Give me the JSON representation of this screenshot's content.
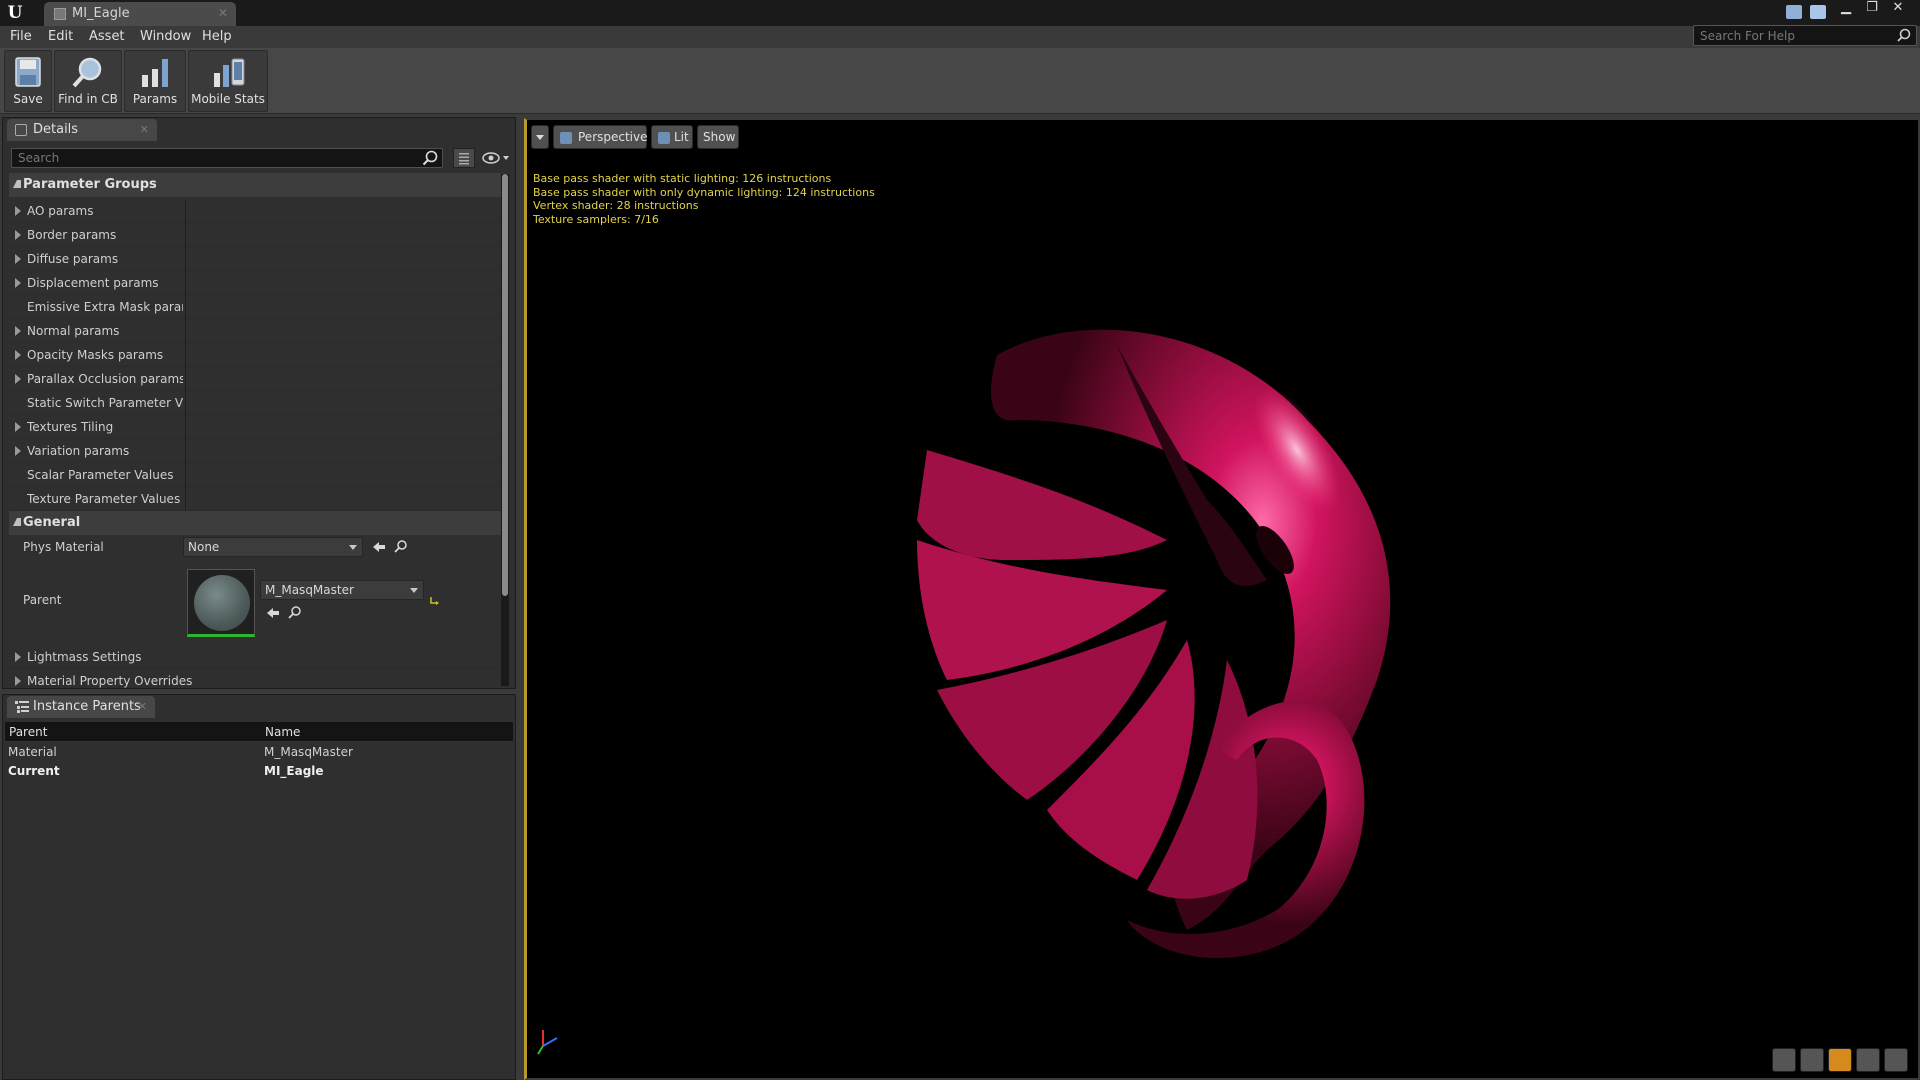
{
  "window": {
    "tab_title": "MI_Eagle"
  },
  "menu": [
    "File",
    "Edit",
    "Asset",
    "Window",
    "Help"
  ],
  "help_search": {
    "placeholder": "Search For Help"
  },
  "toolbar": {
    "save": "Save",
    "find_in_cb": "Find in CB",
    "params": "Params",
    "mobile_stats": "Mobile Stats"
  },
  "details": {
    "tab_label": "Details",
    "search_placeholder": "Search",
    "parameter_groups_header": "Parameter Groups",
    "parameter_groups": [
      "AO params",
      "Border params",
      "Diffuse params",
      "Displacement params",
      "Emissive Extra Mask params",
      "Normal params",
      "Opacity Masks params",
      "Parallax Occlusion params",
      "Static Switch Parameter Values",
      "Textures Tiling",
      "Variation params",
      "Scalar Parameter Values",
      "Texture Parameter Values"
    ],
    "general_header": "General",
    "phys_material_label": "Phys Material",
    "phys_material_value": "None",
    "parent_label": "Parent",
    "parent_value": "M_MasqMaster",
    "lightmass_settings": "Lightmass Settings",
    "material_property_overrides": "Material Property Overrides"
  },
  "instance_parents": {
    "tab_label": "Instance Parents",
    "columns": [
      "Parent",
      "Name"
    ],
    "rows": [
      {
        "parent": "Material",
        "name": "M_MasqMaster",
        "current": false
      },
      {
        "parent": "Current",
        "name": "MI_Eagle",
        "current": true
      }
    ]
  },
  "viewport": {
    "perspective": "Perspective",
    "lit": "Lit",
    "show": "Show",
    "stats": [
      "Base pass shader with static lighting: 126 instructions",
      "Base pass shader with only dynamic lighting: 124 instructions",
      "Vertex shader: 28 instructions",
      "Texture samplers: 7/16"
    ]
  },
  "colors": {
    "eagle": "#c0104f",
    "stats_text": "#e2d24a",
    "viewport_border": "#b89b2e"
  }
}
